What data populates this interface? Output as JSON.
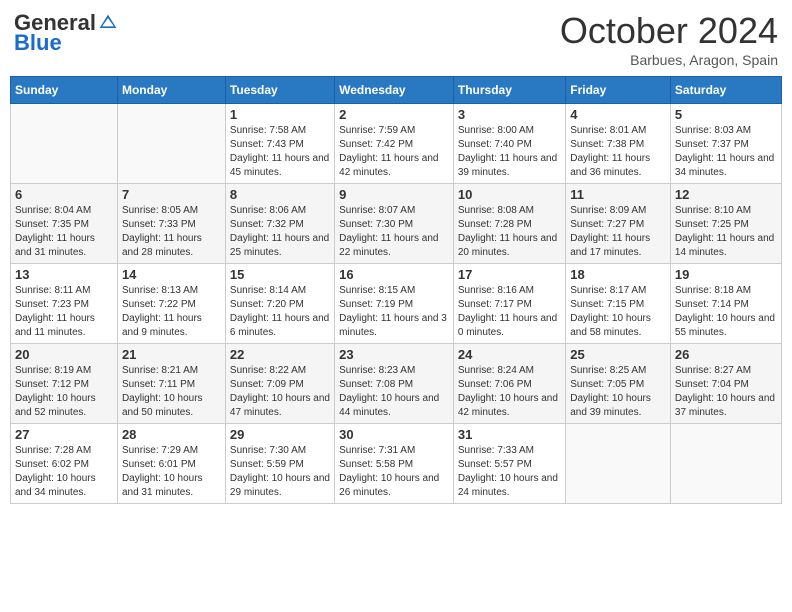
{
  "logo": {
    "general": "General",
    "blue": "Blue"
  },
  "title": "October 2024",
  "subtitle": "Barbues, Aragon, Spain",
  "headers": [
    "Sunday",
    "Monday",
    "Tuesday",
    "Wednesday",
    "Thursday",
    "Friday",
    "Saturday"
  ],
  "weeks": [
    [
      {
        "day": "",
        "info": ""
      },
      {
        "day": "",
        "info": ""
      },
      {
        "day": "1",
        "info": "Sunrise: 7:58 AM\nSunset: 7:43 PM\nDaylight: 11 hours and 45 minutes."
      },
      {
        "day": "2",
        "info": "Sunrise: 7:59 AM\nSunset: 7:42 PM\nDaylight: 11 hours and 42 minutes."
      },
      {
        "day": "3",
        "info": "Sunrise: 8:00 AM\nSunset: 7:40 PM\nDaylight: 11 hours and 39 minutes."
      },
      {
        "day": "4",
        "info": "Sunrise: 8:01 AM\nSunset: 7:38 PM\nDaylight: 11 hours and 36 minutes."
      },
      {
        "day": "5",
        "info": "Sunrise: 8:03 AM\nSunset: 7:37 PM\nDaylight: 11 hours and 34 minutes."
      }
    ],
    [
      {
        "day": "6",
        "info": "Sunrise: 8:04 AM\nSunset: 7:35 PM\nDaylight: 11 hours and 31 minutes."
      },
      {
        "day": "7",
        "info": "Sunrise: 8:05 AM\nSunset: 7:33 PM\nDaylight: 11 hours and 28 minutes."
      },
      {
        "day": "8",
        "info": "Sunrise: 8:06 AM\nSunset: 7:32 PM\nDaylight: 11 hours and 25 minutes."
      },
      {
        "day": "9",
        "info": "Sunrise: 8:07 AM\nSunset: 7:30 PM\nDaylight: 11 hours and 22 minutes."
      },
      {
        "day": "10",
        "info": "Sunrise: 8:08 AM\nSunset: 7:28 PM\nDaylight: 11 hours and 20 minutes."
      },
      {
        "day": "11",
        "info": "Sunrise: 8:09 AM\nSunset: 7:27 PM\nDaylight: 11 hours and 17 minutes."
      },
      {
        "day": "12",
        "info": "Sunrise: 8:10 AM\nSunset: 7:25 PM\nDaylight: 11 hours and 14 minutes."
      }
    ],
    [
      {
        "day": "13",
        "info": "Sunrise: 8:11 AM\nSunset: 7:23 PM\nDaylight: 11 hours and 11 minutes."
      },
      {
        "day": "14",
        "info": "Sunrise: 8:13 AM\nSunset: 7:22 PM\nDaylight: 11 hours and 9 minutes."
      },
      {
        "day": "15",
        "info": "Sunrise: 8:14 AM\nSunset: 7:20 PM\nDaylight: 11 hours and 6 minutes."
      },
      {
        "day": "16",
        "info": "Sunrise: 8:15 AM\nSunset: 7:19 PM\nDaylight: 11 hours and 3 minutes."
      },
      {
        "day": "17",
        "info": "Sunrise: 8:16 AM\nSunset: 7:17 PM\nDaylight: 11 hours and 0 minutes."
      },
      {
        "day": "18",
        "info": "Sunrise: 8:17 AM\nSunset: 7:15 PM\nDaylight: 10 hours and 58 minutes."
      },
      {
        "day": "19",
        "info": "Sunrise: 8:18 AM\nSunset: 7:14 PM\nDaylight: 10 hours and 55 minutes."
      }
    ],
    [
      {
        "day": "20",
        "info": "Sunrise: 8:19 AM\nSunset: 7:12 PM\nDaylight: 10 hours and 52 minutes."
      },
      {
        "day": "21",
        "info": "Sunrise: 8:21 AM\nSunset: 7:11 PM\nDaylight: 10 hours and 50 minutes."
      },
      {
        "day": "22",
        "info": "Sunrise: 8:22 AM\nSunset: 7:09 PM\nDaylight: 10 hours and 47 minutes."
      },
      {
        "day": "23",
        "info": "Sunrise: 8:23 AM\nSunset: 7:08 PM\nDaylight: 10 hours and 44 minutes."
      },
      {
        "day": "24",
        "info": "Sunrise: 8:24 AM\nSunset: 7:06 PM\nDaylight: 10 hours and 42 minutes."
      },
      {
        "day": "25",
        "info": "Sunrise: 8:25 AM\nSunset: 7:05 PM\nDaylight: 10 hours and 39 minutes."
      },
      {
        "day": "26",
        "info": "Sunrise: 8:27 AM\nSunset: 7:04 PM\nDaylight: 10 hours and 37 minutes."
      }
    ],
    [
      {
        "day": "27",
        "info": "Sunrise: 7:28 AM\nSunset: 6:02 PM\nDaylight: 10 hours and 34 minutes."
      },
      {
        "day": "28",
        "info": "Sunrise: 7:29 AM\nSunset: 6:01 PM\nDaylight: 10 hours and 31 minutes."
      },
      {
        "day": "29",
        "info": "Sunrise: 7:30 AM\nSunset: 5:59 PM\nDaylight: 10 hours and 29 minutes."
      },
      {
        "day": "30",
        "info": "Sunrise: 7:31 AM\nSunset: 5:58 PM\nDaylight: 10 hours and 26 minutes."
      },
      {
        "day": "31",
        "info": "Sunrise: 7:33 AM\nSunset: 5:57 PM\nDaylight: 10 hours and 24 minutes."
      },
      {
        "day": "",
        "info": ""
      },
      {
        "day": "",
        "info": ""
      }
    ]
  ]
}
